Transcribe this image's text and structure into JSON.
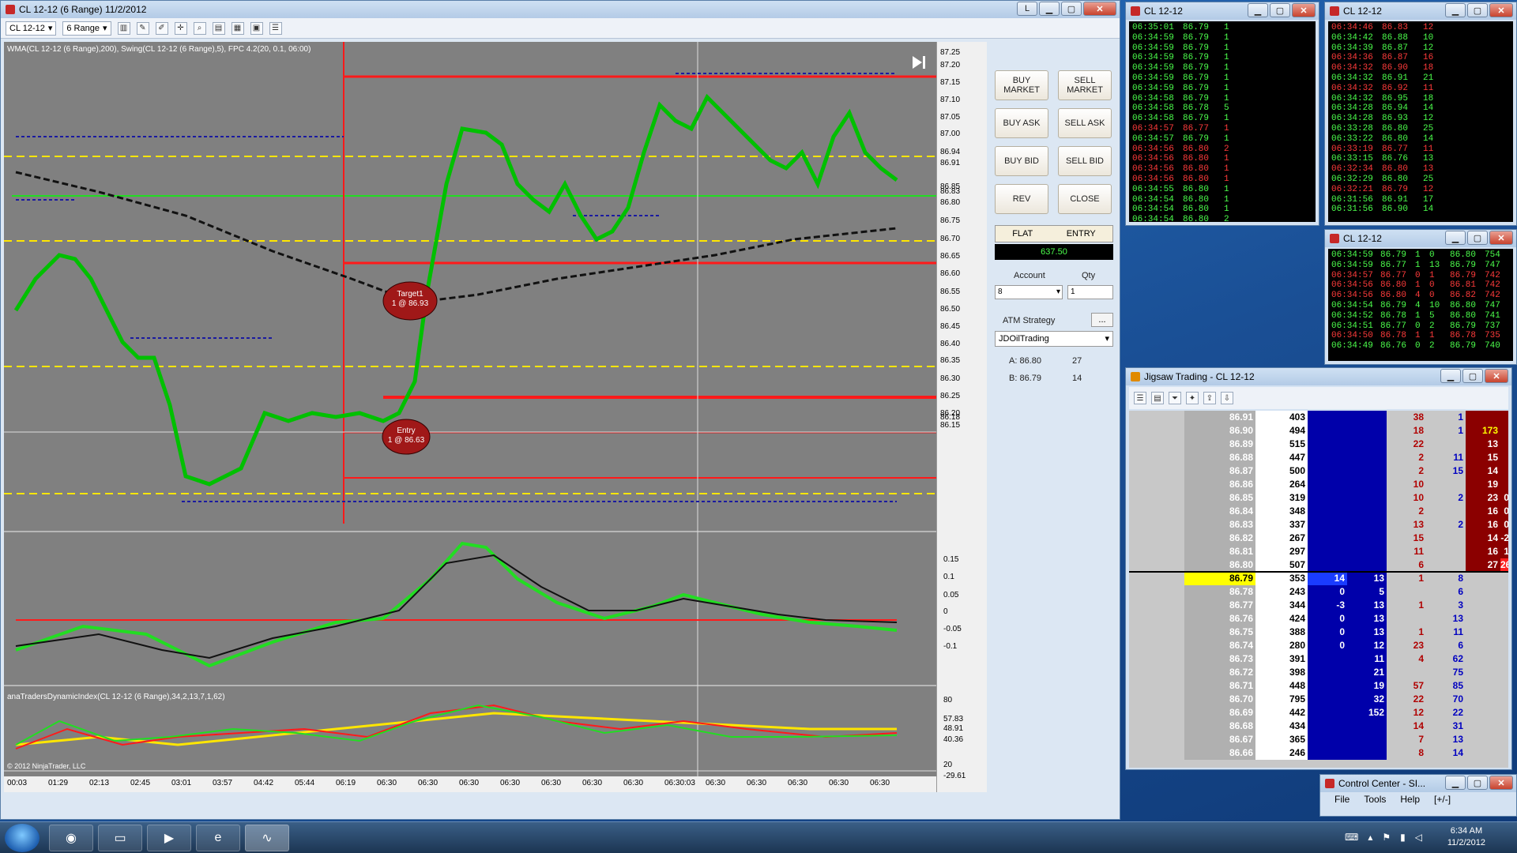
{
  "colors": {
    "accent": "#e00000",
    "buy_green": "#00c000",
    "sell_red": "#cc0000",
    "swing_blue": "#1a1aa0",
    "level_yellow": "#ffe600"
  },
  "main_window": {
    "title": "CL 12-12 (6 Range)  11/2/2012",
    "button_L": "L",
    "toolbar": {
      "instrument": "CL 12-12",
      "period": "6 Range"
    },
    "indicator_label_top": "WMA(CL 12-12 (6 Range),200), Swing(CL 12-12 (6 Range),5), FPC 4.2(20, 0.1, 06:00)",
    "indicator_label_bottom": "anaTradersDynamicIndex(CL 12-12 (6 Range),34,2,13,7,1,62)",
    "copyright": "© 2012 NinjaTrader, LLC",
    "target_label": "Target1",
    "target_value": "1 @ 86.93",
    "entry_label": "Entry",
    "entry_value": "1 @ 86.63",
    "price_levels": [
      "87.25",
      "87.20",
      "87.15",
      "87.10",
      "87.05",
      "87.00",
      "86.94",
      "86.91",
      "86.85",
      "86.83",
      "86.80",
      "86.75",
      "86.70",
      "86.65",
      "86.60",
      "86.55",
      "86.50",
      "86.45",
      "86.40",
      "86.35",
      "86.30",
      "86.25",
      "86.20",
      "86.18",
      "86.15"
    ],
    "osc_levels": [
      "0.15",
      "0.1",
      "0.05",
      "0",
      "-0.05",
      "-0.1"
    ],
    "tdi_levels": [
      "80",
      "57.83",
      "48.91",
      "40.36",
      "20",
      "-29.61"
    ],
    "time_labels": [
      "00:03",
      "01:29",
      "02:13",
      "02:45",
      "03:01",
      "03:57",
      "04:42",
      "05:44",
      "06:19",
      "06:30",
      "06:30",
      "06:30",
      "06:30",
      "06:30",
      "06:30",
      "06:30",
      "06:30:03",
      "06:30",
      "06:30",
      "06:30",
      "06:30",
      "06:30"
    ]
  },
  "chart_data": {
    "type": "line",
    "title": "CL 12-12 (6 Range)",
    "ylim": [
      86.15,
      87.25
    ],
    "series": [
      {
        "name": "WMA(CL 12-12 (6 Range),200)",
        "values": [
          86.98,
          86.93,
          86.88,
          86.82,
          86.76,
          86.7,
          86.66,
          86.66,
          86.68,
          86.71,
          86.74,
          86.76,
          86.79,
          86.81,
          86.83
        ]
      },
      {
        "name": "Price",
        "values": [
          86.62,
          86.74,
          86.6,
          86.5,
          86.22,
          86.3,
          86.42,
          86.4,
          86.37,
          86.45,
          86.63,
          87.05,
          87.02,
          86.88,
          87.15,
          87.12,
          86.98,
          87.0,
          86.92
        ]
      }
    ],
    "categories": [
      "00:03",
      "01:29",
      "02:13",
      "02:45",
      "03:01",
      "03:57",
      "04:42",
      "05:44",
      "06:19",
      "06:30",
      "06:30",
      "06:30",
      "06:30",
      "06:30",
      "06:30",
      "06:30",
      "06:30:03",
      "06:30",
      "06:30"
    ]
  },
  "order_panel": {
    "buy_market": "BUY MARKET",
    "sell_market": "SELL MARKET",
    "buy_ask": "BUY ASK",
    "sell_ask": "SELL ASK",
    "buy_bid": "BUY BID",
    "sell_bid": "SELL BID",
    "rev": "REV",
    "close": "CLOSE",
    "flat": "FLAT",
    "entry": "ENTRY",
    "pnl": "637.50",
    "account_label": "Account",
    "qty_label": "Qty",
    "qty_value": "1",
    "account_value": "8",
    "atm_label": "ATM Strategy",
    "atm_btn": "...",
    "atm_value": "JDOilTrading",
    "ask": "A: 86.80",
    "ask_size": "27",
    "bid": "B: 86.79",
    "bid_size": "14"
  },
  "ts1": {
    "title": "CL 12-12",
    "rows": [
      [
        "06:35:01",
        "86.79",
        "1",
        "g"
      ],
      [
        "06:34:59",
        "86.79",
        "1",
        "g"
      ],
      [
        "06:34:59",
        "86.79",
        "1",
        "g"
      ],
      [
        "06:34:59",
        "86.79",
        "1",
        "g"
      ],
      [
        "06:34:59",
        "86.79",
        "1",
        "g"
      ],
      [
        "06:34:59",
        "86.79",
        "1",
        "g"
      ],
      [
        "06:34:59",
        "86.79",
        "1",
        "g"
      ],
      [
        "06:34:58",
        "86.79",
        "1",
        "g"
      ],
      [
        "06:34:58",
        "86.78",
        "5",
        "g"
      ],
      [
        "06:34:58",
        "86.79",
        "1",
        "g"
      ],
      [
        "06:34:57",
        "86.77",
        "1",
        "r"
      ],
      [
        "06:34:57",
        "86.79",
        "1",
        "g"
      ],
      [
        "06:34:56",
        "86.80",
        "2",
        "r"
      ],
      [
        "06:34:56",
        "86.80",
        "1",
        "r"
      ],
      [
        "06:34:56",
        "86.80",
        "1",
        "r"
      ],
      [
        "06:34:56",
        "86.80",
        "1",
        "r"
      ],
      [
        "06:34:55",
        "86.80",
        "1",
        "g"
      ],
      [
        "06:34:54",
        "86.80",
        "1",
        "g"
      ],
      [
        "06:34:54",
        "86.80",
        "1",
        "g"
      ],
      [
        "06:34:54",
        "86.80",
        "2",
        "g"
      ]
    ]
  },
  "ts2": {
    "title": "CL 12-12",
    "rows": [
      [
        "06:34:46",
        "86.83",
        "12",
        "r"
      ],
      [
        "06:34:42",
        "86.88",
        "10",
        "g"
      ],
      [
        "06:34:39",
        "86.87",
        "12",
        "g"
      ],
      [
        "06:34:36",
        "86.87",
        "16",
        "r"
      ],
      [
        "06:34:32",
        "86.90",
        "18",
        "r"
      ],
      [
        "06:34:32",
        "86.91",
        "21",
        "g"
      ],
      [
        "06:34:32",
        "86.92",
        "11",
        "r"
      ],
      [
        "06:34:32",
        "86.95",
        "18",
        "g"
      ],
      [
        "06:34:28",
        "86.94",
        "14",
        "g"
      ],
      [
        "06:34:28",
        "86.93",
        "12",
        "g"
      ],
      [
        "06:33:28",
        "86.80",
        "25",
        "g"
      ],
      [
        "06:33:22",
        "86.80",
        "14",
        "g"
      ],
      [
        "06:33:19",
        "86.77",
        "11",
        "r"
      ],
      [
        "06:33:15",
        "86.76",
        "13",
        "g"
      ],
      [
        "06:32:34",
        "86.80",
        "13",
        "r"
      ],
      [
        "06:32:29",
        "86.80",
        "25",
        "g"
      ],
      [
        "06:32:21",
        "86.79",
        "12",
        "r"
      ],
      [
        "06:31:56",
        "86.91",
        "17",
        "g"
      ],
      [
        "06:31:56",
        "86.90",
        "14",
        "g"
      ]
    ]
  },
  "ts3": {
    "title": "CL 12-12",
    "rows": [
      [
        "06:34:59",
        "86.79",
        "1",
        "0",
        "86.80",
        "754",
        "g"
      ],
      [
        "06:34:59",
        "86.77",
        "1",
        "13",
        "86.79",
        "747",
        "g"
      ],
      [
        "06:34:57",
        "86.77",
        "0",
        "1",
        "86.79",
        "742",
        "r"
      ],
      [
        "06:34:56",
        "86.80",
        "1",
        "0",
        "86.81",
        "742",
        "r"
      ],
      [
        "06:34:56",
        "86.80",
        "4",
        "0",
        "86.82",
        "742",
        "r"
      ],
      [
        "06:34:54",
        "86.79",
        "4",
        "10",
        "86.80",
        "747",
        "g"
      ],
      [
        "06:34:52",
        "86.78",
        "1",
        "5",
        "86.80",
        "741",
        "g"
      ],
      [
        "06:34:51",
        "86.77",
        "0",
        "2",
        "86.79",
        "737",
        "g"
      ],
      [
        "06:34:50",
        "86.78",
        "1",
        "1",
        "86.78",
        "735",
        "r"
      ],
      [
        "06:34:49",
        "86.76",
        "0",
        "2",
        "86.79",
        "740",
        "g"
      ]
    ]
  },
  "jigsaw": {
    "title": "Jigsaw Trading - CL 12-12",
    "rows": [
      {
        "price": "86.91",
        "vol": "403",
        "b1": "",
        "b2": "",
        "s1": "38",
        "s2": "1",
        "a1": "",
        "a2": ""
      },
      {
        "price": "86.90",
        "vol": "494",
        "b1": "",
        "b2": "",
        "s1": "18",
        "s2": "1",
        "a1": "173",
        "a2": ""
      },
      {
        "price": "86.89",
        "vol": "515",
        "b1": "",
        "b2": "",
        "s1": "22",
        "s2": "",
        "a1": "13",
        "a2": ""
      },
      {
        "price": "86.88",
        "vol": "447",
        "b1": "",
        "b2": "",
        "s1": "2",
        "s2": "11",
        "a1": "15",
        "a2": ""
      },
      {
        "price": "86.87",
        "vol": "500",
        "b1": "",
        "b2": "",
        "s1": "2",
        "s2": "15",
        "a1": "14",
        "a2": ""
      },
      {
        "price": "86.86",
        "vol": "264",
        "b1": "",
        "b2": "",
        "s1": "10",
        "s2": "",
        "a1": "19",
        "a2": ""
      },
      {
        "price": "86.85",
        "vol": "319",
        "b1": "",
        "b2": "",
        "s1": "10",
        "s2": "2",
        "a1": "23",
        "a2": "0"
      },
      {
        "price": "86.84",
        "vol": "348",
        "b1": "",
        "b2": "",
        "s1": "2",
        "s2": "",
        "a1": "16",
        "a2": "0"
      },
      {
        "price": "86.83",
        "vol": "337",
        "b1": "",
        "b2": "",
        "s1": "13",
        "s2": "2",
        "a1": "16",
        "a2": "0"
      },
      {
        "price": "86.82",
        "vol": "267",
        "b1": "",
        "b2": "",
        "s1": "15",
        "s2": "",
        "a1": "14",
        "a2": "-2"
      },
      {
        "price": "86.81",
        "vol": "297",
        "b1": "",
        "b2": "",
        "s1": "11",
        "s2": "",
        "a1": "16",
        "a2": "1"
      },
      {
        "price": "86.80",
        "vol": "507",
        "b1": "",
        "b2": "",
        "s1": "6",
        "s2": "",
        "a1": "27",
        "a2": "26"
      },
      {
        "price": "86.79",
        "vol": "353",
        "b1": "14",
        "b2": "13",
        "s1": "1",
        "s2": "8",
        "a1": "",
        "a2": ""
      },
      {
        "price": "86.78",
        "vol": "243",
        "b1": "0",
        "b2": "5",
        "s1": "",
        "s2": "6",
        "a1": "",
        "a2": ""
      },
      {
        "price": "86.77",
        "vol": "344",
        "b1": "-3",
        "b2": "13",
        "s1": "1",
        "s2": "3",
        "a1": "",
        "a2": ""
      },
      {
        "price": "86.76",
        "vol": "424",
        "b1": "0",
        "b2": "13",
        "s1": "",
        "s2": "13",
        "a1": "",
        "a2": ""
      },
      {
        "price": "86.75",
        "vol": "388",
        "b1": "0",
        "b2": "13",
        "s1": "1",
        "s2": "11",
        "a1": "",
        "a2": ""
      },
      {
        "price": "86.74",
        "vol": "280",
        "b1": "0",
        "b2": "12",
        "s1": "23",
        "s2": "6",
        "a1": "",
        "a2": ""
      },
      {
        "price": "86.73",
        "vol": "391",
        "b1": "",
        "b2": "11",
        "s1": "4",
        "s2": "62",
        "a1": "",
        "a2": ""
      },
      {
        "price": "86.72",
        "vol": "398",
        "b1": "",
        "b2": "21",
        "s1": "",
        "s2": "75",
        "a1": "",
        "a2": ""
      },
      {
        "price": "86.71",
        "vol": "448",
        "b1": "",
        "b2": "19",
        "s1": "57",
        "s2": "85",
        "a1": "",
        "a2": ""
      },
      {
        "price": "86.70",
        "vol": "795",
        "b1": "",
        "b2": "32",
        "s1": "22",
        "s2": "70",
        "a1": "",
        "a2": ""
      },
      {
        "price": "86.69",
        "vol": "442",
        "b1": "",
        "b2": "152",
        "s1": "12",
        "s2": "22",
        "a1": "",
        "a2": ""
      },
      {
        "price": "86.68",
        "vol": "434",
        "b1": "",
        "b2": "",
        "s1": "14",
        "s2": "31",
        "a1": "",
        "a2": ""
      },
      {
        "price": "86.67",
        "vol": "365",
        "b1": "",
        "b2": "",
        "s1": "7",
        "s2": "13",
        "a1": "",
        "a2": ""
      },
      {
        "price": "86.66",
        "vol": "246",
        "b1": "",
        "b2": "",
        "s1": "8",
        "s2": "14",
        "a1": "",
        "a2": ""
      }
    ]
  },
  "control_center": {
    "title": "Control Center - SI...",
    "menu": [
      "File",
      "Tools",
      "Help",
      "[+/-]"
    ]
  },
  "taskbar": {
    "time": "6:34 AM",
    "date": "11/2/2012"
  }
}
